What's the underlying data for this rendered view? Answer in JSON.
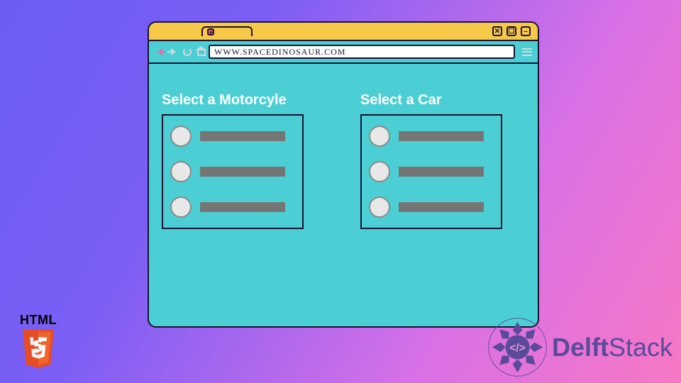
{
  "browser": {
    "url": "WWW.SPACEDINOSAUR.COM"
  },
  "panels": [
    {
      "title": "Select a Motorcyle"
    },
    {
      "title": "Select a Car"
    }
  ],
  "badges": {
    "html5": "HTML",
    "delftstack_bold": "Delft",
    "delftstack_rest": "Stack"
  }
}
